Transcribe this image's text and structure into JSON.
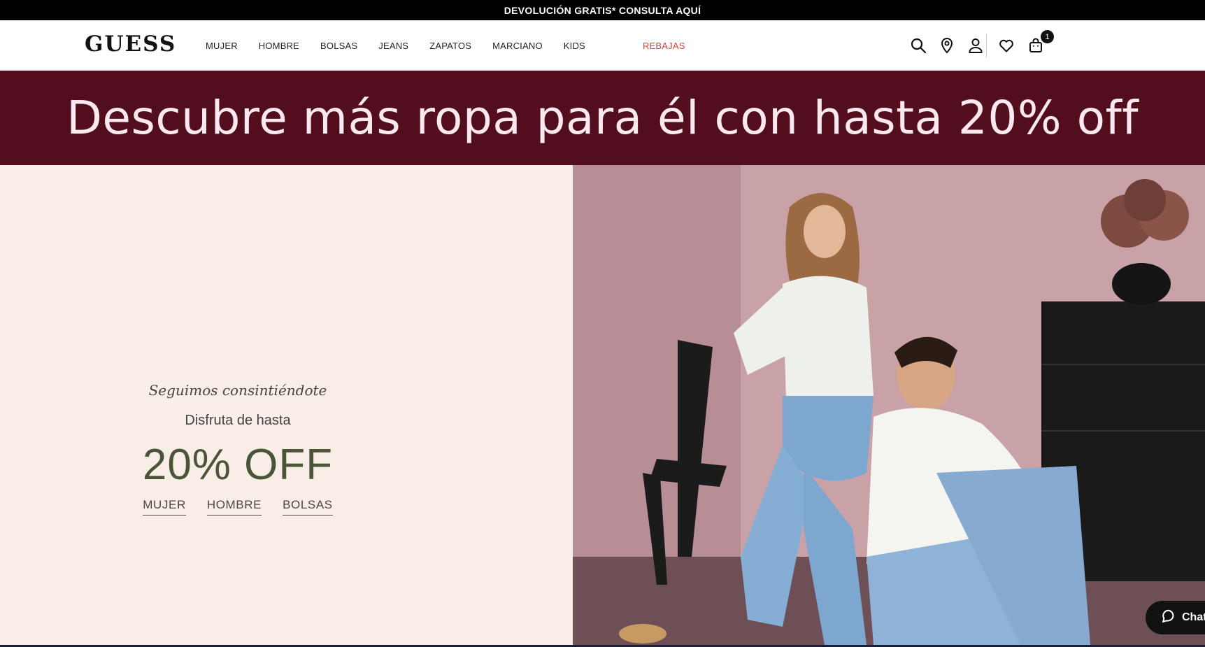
{
  "topbar": {
    "promo_text": "DEVOLUCIÓN GRATIS* CONSULTA AQUÍ"
  },
  "header": {
    "logo": "GUESS",
    "nav": [
      {
        "label": "MUJER"
      },
      {
        "label": "HOMBRE"
      },
      {
        "label": "BOLSAS"
      },
      {
        "label": "JEANS"
      },
      {
        "label": "ZAPATOS"
      },
      {
        "label": "MARCIANO"
      },
      {
        "label": "KIDS"
      },
      {
        "label": "REBAJAS",
        "color": "#d9443a"
      }
    ],
    "icons": [
      "search-icon",
      "location-pin-icon",
      "user-icon",
      "heart-icon",
      "shopping-bag-icon"
    ],
    "cart_count": "1"
  },
  "banner": {
    "text": "Descubre más ropa para él con hasta 20% off",
    "background": "#520e1f"
  },
  "hero": {
    "tagline": "Seguimos consintiéndote",
    "subtitle": "Disfruta de hasta",
    "discount": "20% OFF",
    "links": [
      {
        "label": "MUJER"
      },
      {
        "label": "HOMBRE"
      },
      {
        "label": "BOLSAS"
      }
    ],
    "panel_background": "#f9eee7",
    "accent_color": "#4a5437"
  },
  "chat": {
    "label": "Chat"
  }
}
